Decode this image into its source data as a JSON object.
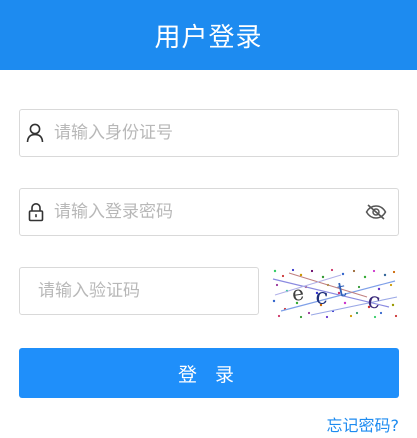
{
  "header": {
    "title": "用户登录"
  },
  "form": {
    "id_card": {
      "placeholder": "请输入身份证号",
      "icon": "user-icon"
    },
    "password": {
      "placeholder": "请输入登录密码",
      "icon": "lock-icon",
      "toggle_icon": "eye-slash-icon"
    },
    "captcha": {
      "placeholder": "请输入验证码",
      "image_text": "ectc"
    },
    "submit_label": "登 录",
    "forgot_link": "忘记密码?"
  },
  "colors": {
    "primary": "#1d8bf0",
    "button": "#1f8ffa",
    "border": "#d9d9d9",
    "placeholder": "#b8b8b8"
  }
}
